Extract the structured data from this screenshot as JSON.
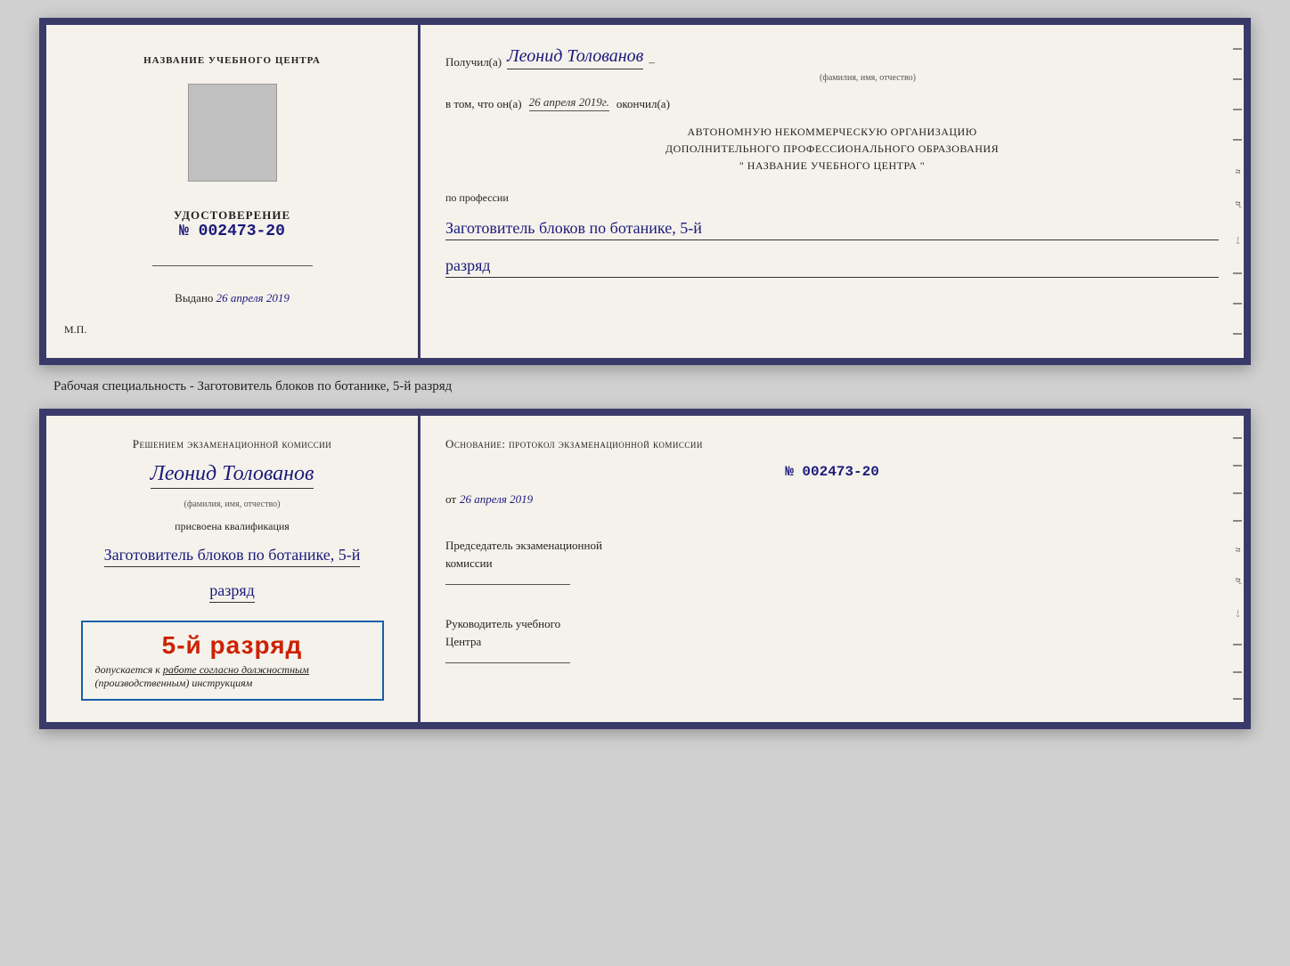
{
  "top_card": {
    "left": {
      "school_name": "НАЗВАНИЕ УЧЕБНОГО ЦЕНТРА",
      "udostoverenie_label": "УДОСТОВЕРЕНИЕ",
      "number": "№ 002473-20",
      "vydano_prefix": "Выдано",
      "vydano_date": "26 апреля 2019",
      "mp_label": "М.П."
    },
    "right": {
      "poluchil_prefix": "Получил(а)",
      "full_name": "Леонид Толованов",
      "name_subtitle": "(фамилия, имя, отчество)",
      "vtom_prefix": "в том, что он(а)",
      "vtom_date": "26 апреля 2019г.",
      "okonchil": "окончил(а)",
      "avt_line1": "АВТОНОМНУЮ НЕКОММЕРЧЕСКУЮ ОРГАНИЗАЦИЮ",
      "avt_line2": "ДОПОЛНИТЕЛЬНОГО ПРОФЕССИОНАЛЬНОГО ОБРАЗОВАНИЯ",
      "avt_line3": "\"  НАЗВАНИЕ УЧЕБНОГО ЦЕНТРА  \"",
      "po_professii": "по профессии",
      "profession": "Заготовитель блоков по ботанике, 5-й",
      "razryad": "разряд"
    }
  },
  "specialty_label": "Рабочая специальность - Заготовитель блоков по ботанике, 5-й разряд",
  "bottom_card": {
    "left": {
      "resheniem": "Решением экзаменационной комиссии",
      "full_name": "Леонид Толованов",
      "name_subtitle": "(фамилия, имя, отчество)",
      "prisvoena": "присвоена квалификация",
      "profession": "Заготовитель блоков по ботанике, 5-й",
      "razryad": "разряд",
      "stamp_text": "5-й разряд",
      "stamp_sub1": "допускается к",
      "stamp_sub2": "работе согласно должностным",
      "stamp_sub3": "(производственным) инструкциям"
    },
    "right": {
      "osnov": "Основание: протокол экзаменационной комиссии",
      "number": "№ 002473-20",
      "ot_prefix": "от",
      "ot_date": "26 апреля 2019",
      "predsedatel_line1": "Председатель экзаменационной",
      "predsedatel_line2": "комиссии",
      "rukov_line1": "Руководитель учебного",
      "rukov_line2": "Центра"
    }
  }
}
